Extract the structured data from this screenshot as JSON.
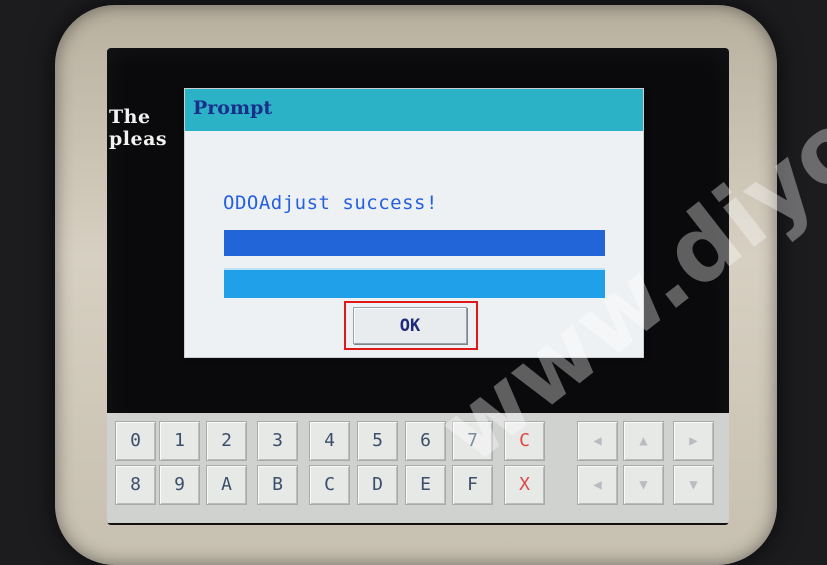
{
  "background_text": {
    "line1": "The",
    "line2": "pleas"
  },
  "dialog": {
    "title": "Prompt",
    "message": "ODOAdjust success!",
    "ok_label": "OK"
  },
  "keypad": {
    "row1": [
      "0",
      "1",
      "2",
      "3",
      "4",
      "5",
      "6",
      "7",
      "C"
    ],
    "row2": [
      "8",
      "9",
      "A",
      "B",
      "C",
      "D",
      "E",
      "F",
      "X"
    ],
    "nav_row1": [
      "left-arrow-icon",
      "up-arrow-icon",
      "right-arrow-icon"
    ],
    "nav_row2": [
      "left-arrow-icon",
      "down-arrow-icon",
      "down-arrow-icon"
    ]
  },
  "watermark": "www.diyob",
  "colors": {
    "title_bar": "#2cb2c7",
    "message_text": "#2460e0",
    "progress_bar_1": "#2265d8",
    "progress_bar_2": "#1fa0e8",
    "highlight": "#e01818"
  }
}
